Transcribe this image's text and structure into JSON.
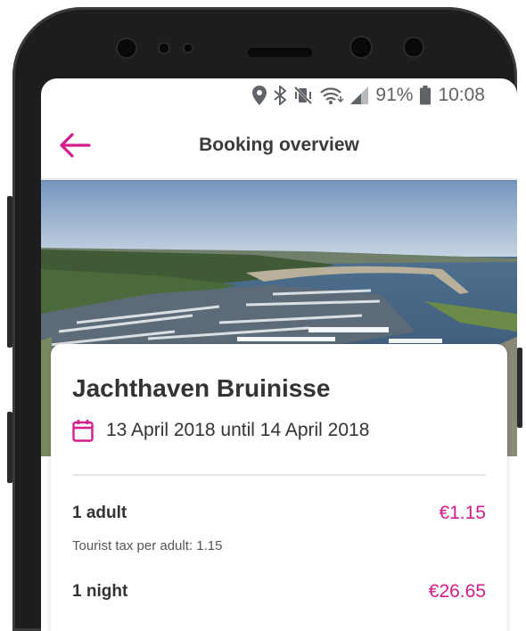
{
  "status_bar": {
    "battery": "91%",
    "time": "10:08",
    "icons": [
      "location-icon",
      "bluetooth-icon",
      "vibrate-icon",
      "wifi-icon",
      "signal-icon",
      "battery-icon"
    ]
  },
  "appbar": {
    "title": "Booking overview",
    "back_icon": "arrow-left-icon"
  },
  "colors": {
    "accent": "#d31d8c",
    "text": "#333333"
  },
  "card": {
    "title": "Jachthaven Bruinisse",
    "dates": "13 April 2018 until 14 April 2018",
    "date_icon": "calendar-icon",
    "items": [
      {
        "label": "1 adult",
        "price": "€1.15",
        "note": "Tourist tax per adult: 1.15"
      },
      {
        "label": "1 night",
        "price": "€26.65"
      }
    ]
  }
}
